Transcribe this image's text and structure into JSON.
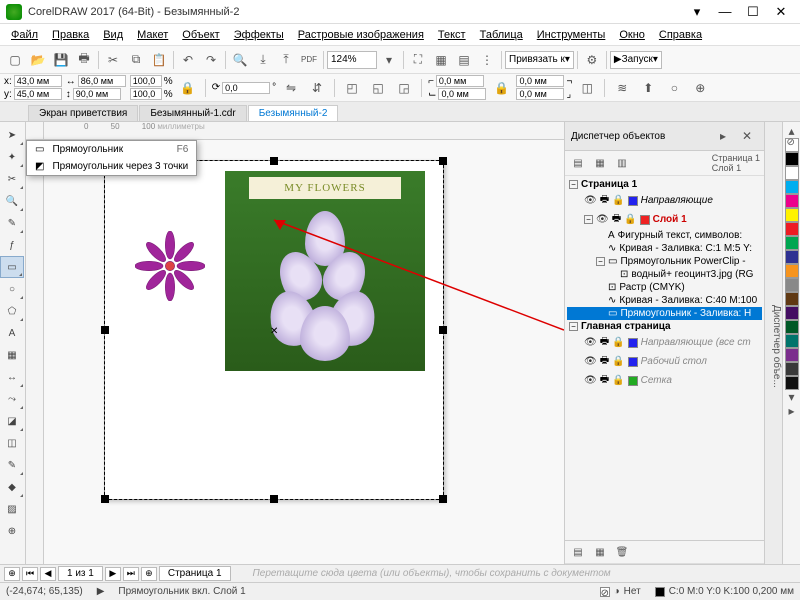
{
  "app": {
    "title": "CorelDRAW 2017 (64-Bit) - Безымянный-2"
  },
  "menu": [
    "Файл",
    "Правка",
    "Вид",
    "Макет",
    "Объект",
    "Эффекты",
    "Растровые изображения",
    "Текст",
    "Таблица",
    "Инструменты",
    "Окно",
    "Справка"
  ],
  "toolbar": {
    "zoom": "124%",
    "snap_label": "Привязать к",
    "launch_label": "Запуск"
  },
  "props": {
    "x": "43,0 мм",
    "y": "45,0 мм",
    "w": "86,0 мм",
    "h": "90,0 мм",
    "sx": "100,0",
    "sy": "100,0",
    "angle": "0,0",
    "cr": "0,0 мм",
    "cr2": "0,0 мм",
    "cr3": "0,0 мм",
    "cr4": "0,0 мм"
  },
  "tabs": {
    "items": [
      "Экран приветствия",
      "Безымянный-1.cdr",
      "Безымянный-2"
    ],
    "active": 2
  },
  "flyout": {
    "row1": "Прямоугольник",
    "row1_key": "F6",
    "row2": "Прямоугольник через 3 точки"
  },
  "canvas": {
    "photo_label": "MY FLOWERS",
    "ruler_units": "миллиметры"
  },
  "dock": {
    "title": "Диспетчер объектов",
    "page": "Страница 1",
    "layer": "Слой 1",
    "tree": {
      "page1": "Страница 1",
      "guides": "Направляющие",
      "layer1": "Слой 1",
      "art_text": "Фигурный текст, символов:",
      "curve1": "Кривая - Заливка: C:1 M:5 Y:",
      "powerclip": "Прямоугольник PowerClip -",
      "bitmap": "водный+ геоцинт3.jpg (RG",
      "raster": "Растр (CMYK)",
      "curve2": "Кривая - Заливка: C:40 M:100",
      "rect_sel": "Прямоугольник - Заливка: Н",
      "master": "Главная страница",
      "master_guides": "Направляющие (все ст",
      "desktop": "Рабочий стол",
      "grid": "Сетка"
    },
    "side_tab": "Диспетчер объе..."
  },
  "palette": [
    "#ffffff",
    "#00aeef",
    "#ec008c",
    "#fff200",
    "#ed1c24",
    "#00a651",
    "#2e3192",
    "#f7941d",
    "#898989",
    "#603913",
    "#440e62",
    "#005826",
    "#00746b",
    "#7b2e8d",
    "#393939",
    "#101010"
  ],
  "pagebar": {
    "pos": "1 из 1",
    "page_tab": "Страница 1",
    "hint": "Перетащите сюда цвета (или объекты), чтобы сохранить с документом"
  },
  "status": {
    "coords": "(-24,674; 65,135)",
    "object": "Прямоугольник вкл. Слой 1",
    "fill_none": "Нет",
    "outline": "C:0 M:0 Y:0 K:100  0,200 мм"
  }
}
